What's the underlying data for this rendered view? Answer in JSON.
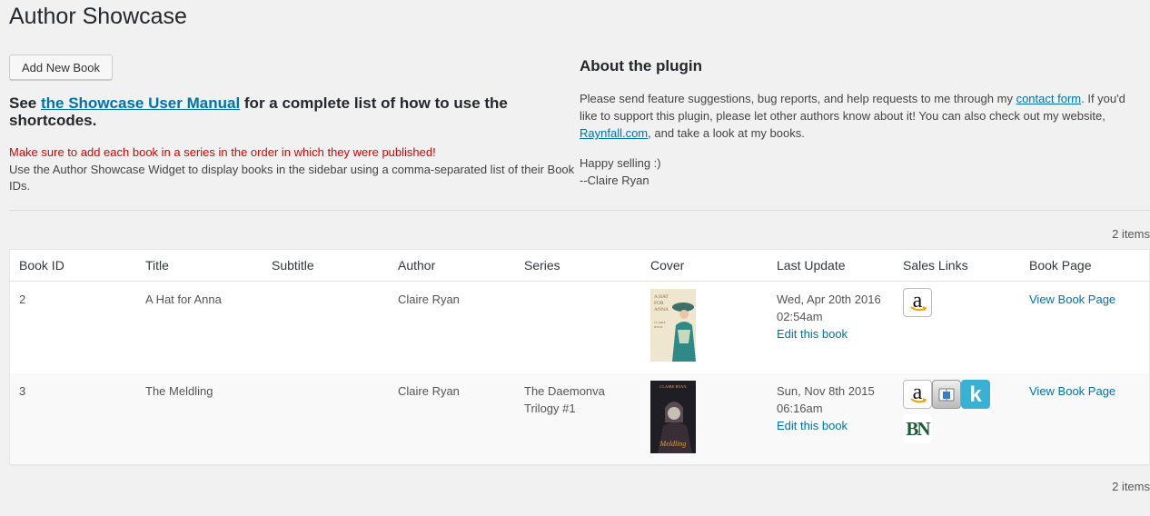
{
  "page": {
    "title": "Author Showcase",
    "add_new_label": "Add New Book",
    "see_prefix": "See ",
    "manual_link": "the Showcase User Manual",
    "see_suffix": " for a complete list of how to use the shortcodes.",
    "warning": "Make sure to add each book in a series in the order in which they were published!",
    "widget_note": "Use the Author Showcase Widget to display books in the sidebar using a comma-separated list of their Book IDs."
  },
  "about": {
    "title": "About the plugin",
    "text_1": "Please send feature suggestions, bug reports, and help requests to me through my ",
    "contact_link": "contact form",
    "text_2": ". If you'd like to support this plugin, please let other authors know about it! You can also check out my website, ",
    "website_link": "Raynfall.com",
    "text_3": ", and take a look at my books.",
    "happy": "Happy selling :)",
    "signature": "--Claire Ryan"
  },
  "table": {
    "items_count": "2 items",
    "columns": [
      "Book ID",
      "Title",
      "Subtitle",
      "Author",
      "Series",
      "Cover",
      "Last Update",
      "Sales Links",
      "Book Page"
    ],
    "rows": [
      {
        "book_id": "2",
        "title": "A Hat for Anna",
        "subtitle": "",
        "author": "Claire Ryan",
        "series": "",
        "cover_title": "A HAT FOR ANNA",
        "cover_author": "CLAIRE RYAN",
        "last_update_date": "Wed, Apr 20th 2016",
        "last_update_time": "02:54am",
        "edit_label": "Edit this book",
        "sales_links": [
          "amazon-icon"
        ],
        "book_page_label": "View Book Page"
      },
      {
        "book_id": "3",
        "title": "The Meldling",
        "subtitle": "",
        "author": "Claire Ryan",
        "series": "The Daemonva Trilogy #1",
        "cover_title": "The Meldling",
        "cover_author": "CLAIRE RYAN",
        "last_update_date": "Sun, Nov 8th 2015",
        "last_update_time": "06:16am",
        "edit_label": "Edit this book",
        "sales_links": [
          "amazon-icon",
          "ibooks-icon",
          "kobo-icon",
          "barnes-noble-icon"
        ],
        "book_page_label": "View Book Page"
      }
    ]
  },
  "icons": {
    "amazon_letter": "a",
    "kobo_letter": "k",
    "bn_letters": "BN"
  },
  "colors": {
    "link": "#0073aa",
    "warning": "#dd0000",
    "kobo": "#3ab0d3",
    "bn": "#1f5c3a"
  }
}
